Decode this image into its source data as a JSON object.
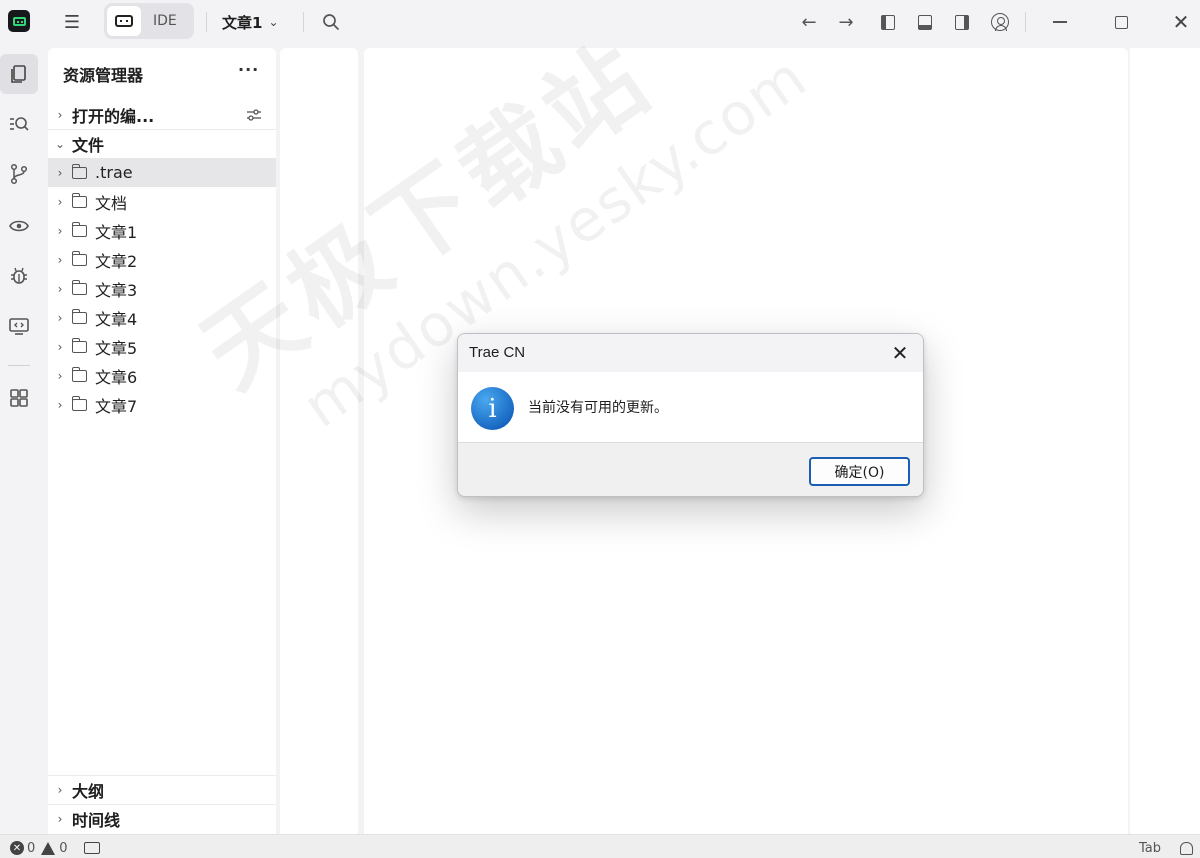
{
  "titlebar": {
    "mode_label": "IDE",
    "project_name": "文章1"
  },
  "explorer": {
    "title": "资源管理器",
    "more_label": "···",
    "open_editors_label": "打开的编...",
    "files_label": "文件",
    "items": [
      {
        "name": ".trae",
        "selected": true
      },
      {
        "name": "文档"
      },
      {
        "name": "文章1"
      },
      {
        "name": "文章2"
      },
      {
        "name": "文章3"
      },
      {
        "name": "文章4"
      },
      {
        "name": "文章5"
      },
      {
        "name": "文章6"
      },
      {
        "name": "文章7"
      }
    ],
    "outline_label": "大纲",
    "timeline_label": "时间线"
  },
  "watermark": {
    "line1": "天极下载站",
    "line2": "mydown.yesky.com"
  },
  "dialog": {
    "title": "Trae CN",
    "message": "当前没有可用的更新。",
    "ok_label": "确定(O)",
    "info_glyph": "i"
  },
  "statusbar": {
    "errors": "0",
    "warnings": "0",
    "tab_label": "Tab"
  }
}
